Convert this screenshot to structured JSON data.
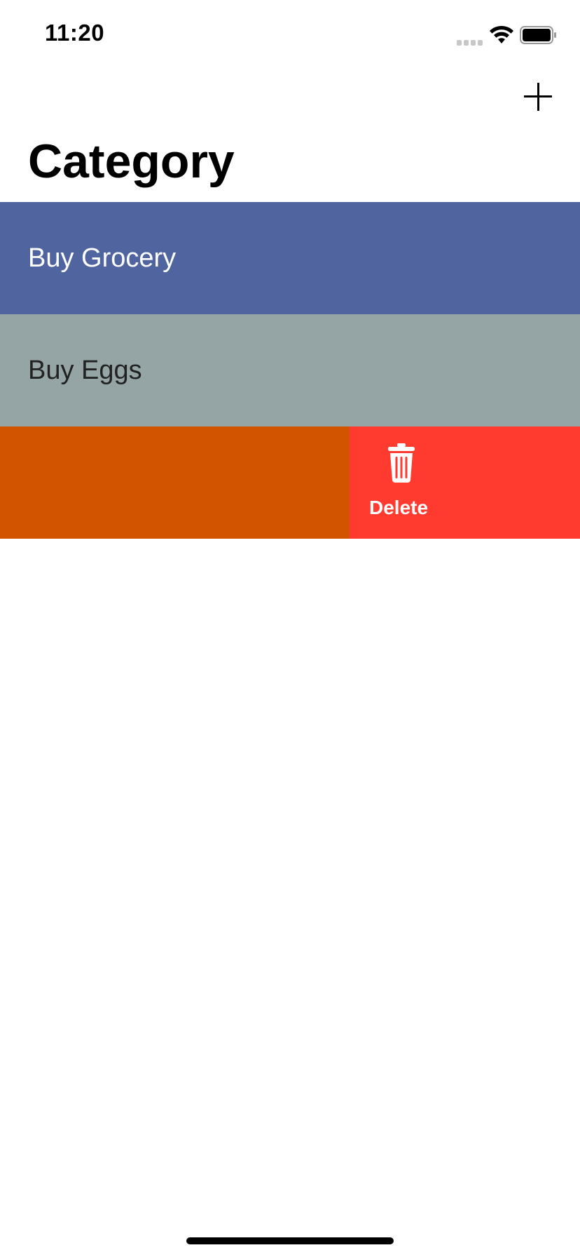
{
  "status_bar": {
    "time": "11:20"
  },
  "nav": {
    "title": "Category",
    "add_icon": "plus-icon"
  },
  "list": {
    "rows": [
      {
        "label": "Buy Grocery",
        "background": "#5064a0",
        "text_color": "#ffffff"
      },
      {
        "label": "Buy Eggs",
        "background": "#95a5a6",
        "text_color": "#222222"
      },
      {
        "label": "",
        "background": "#d35400",
        "text_color": "#ffffff"
      }
    ],
    "swipe_action": {
      "label": "Delete",
      "icon": "trash-icon",
      "background": "#ff3b30"
    }
  }
}
